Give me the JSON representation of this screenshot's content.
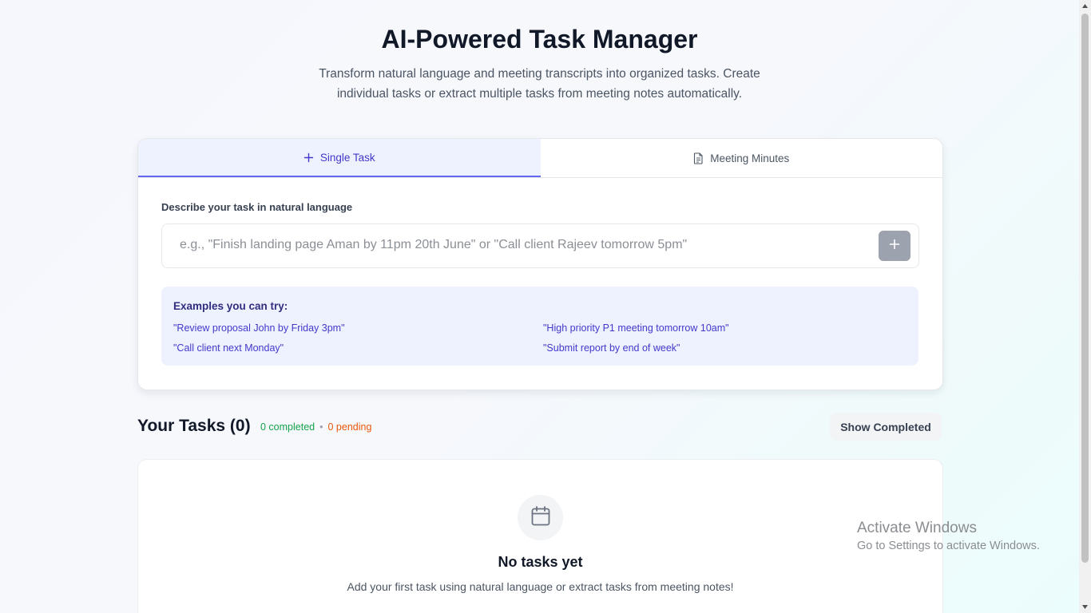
{
  "header": {
    "title": "AI-Powered Task Manager",
    "subtitle": "Transform natural language and meeting transcripts into organized tasks. Create individual tasks or extract multiple tasks from meeting notes automatically."
  },
  "tabs": [
    {
      "label": "Single Task",
      "icon": "plus-icon",
      "active": true
    },
    {
      "label": "Meeting Minutes",
      "icon": "document-icon",
      "active": false
    }
  ],
  "single_task": {
    "field_label": "Describe your task in natural language",
    "input_value": "",
    "input_placeholder": "e.g., \"Finish landing page Aman by 11pm 20th June\" or \"Call client Rajeev tomorrow 5pm\"",
    "add_button_icon": "plus-icon"
  },
  "examples": {
    "title": "Examples you can try:",
    "items": [
      "\"Review proposal John by Friday 3pm\"",
      "\"High priority P1 meeting tomorrow 10am\"",
      "\"Call client next Monday\"",
      "\"Submit report by end of week\""
    ]
  },
  "tasks": {
    "title": "Your Tasks (0)",
    "completed_text": "0 completed",
    "separator": "•",
    "pending_text": "0 pending",
    "show_completed_label": "Show Completed"
  },
  "empty_state": {
    "icon": "calendar-icon",
    "title": "No tasks yet",
    "description": "Add your first task using natural language or extract tasks from meeting notes!"
  },
  "os_watermark": {
    "title": "Activate Windows",
    "subtitle": "Go to Settings to activate Windows."
  },
  "colors": {
    "accent": "#4338ca",
    "accent_light": "#eef2ff",
    "completed": "#16a34a",
    "pending": "#ea580c",
    "add_button": "#9ca3af"
  }
}
